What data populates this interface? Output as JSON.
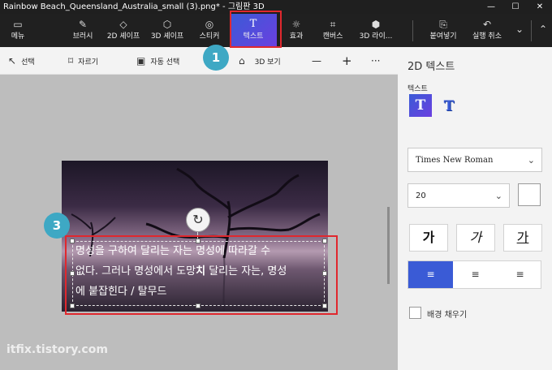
{
  "window": {
    "title": "Rainbow Beach_Queensland_Australia_small (3).png* - 그림판 3D",
    "controls": [
      "—",
      "☐",
      "✕"
    ]
  },
  "toolbar": {
    "items": [
      {
        "label": "메뉴",
        "icon": "folder-icon",
        "glyph": "▭"
      },
      {
        "label": "브러시",
        "icon": "brush-icon",
        "glyph": "✎"
      },
      {
        "label": "2D 셰이프",
        "icon": "2d-shapes-icon",
        "glyph": "◇"
      },
      {
        "label": "3D 셰이프",
        "icon": "3d-shapes-icon",
        "glyph": "⬡"
      },
      {
        "label": "스티커",
        "icon": "sticker-icon",
        "glyph": "◎"
      },
      {
        "label": "텍스트",
        "icon": "text-icon",
        "glyph": "T"
      },
      {
        "label": "효과",
        "icon": "effects-icon",
        "glyph": "☼"
      },
      {
        "label": "캔버스",
        "icon": "canvas-icon",
        "glyph": "⌗"
      },
      {
        "label": "3D 라이...",
        "icon": "3d-library-icon",
        "glyph": "⬢"
      },
      {
        "label": "붙여넣기",
        "icon": "paste-icon",
        "glyph": "⎘"
      },
      {
        "label": "실행 취소",
        "icon": "undo-icon",
        "glyph": "↶"
      }
    ],
    "more_glyph": "⌄",
    "collapse_glyph": "⌃"
  },
  "subbar": {
    "select": {
      "label": "선택",
      "glyph": "↖"
    },
    "crop": {
      "label": "자르기",
      "glyph": "⌑"
    },
    "magic_select": {
      "label": "자동 선택",
      "glyph": "▣"
    },
    "view3d": {
      "label": "3D 보기",
      "glyph": "⌂"
    },
    "zoom_out": "—",
    "zoom_in": "+",
    "more": "···"
  },
  "canvas": {
    "text_line1": "명성을 구하여 달리는 자는 명성에 따라갈 수",
    "text_line2_a": "없다. 그러나 명성에서 도망",
    "text_line2_bold": "치",
    "text_line2_b": " 달리는 자는, 명성",
    "text_line3": "에 붙잡힌다 / 탈무드",
    "rotate_glyph": "↻"
  },
  "annotations": {
    "callout1": "1",
    "callout2": "2",
    "callout3": "3",
    "accent": "#e0282e",
    "callout_color": "#3ea8c4"
  },
  "watermark": "itfix.tistory.com",
  "panel": {
    "title": "2D 텍스트",
    "subtitle": "텍스트",
    "text_2d_glyph": "T",
    "text_3d_glyph": "T",
    "font": "Times New Roman",
    "size": "20",
    "chevron": "⌄",
    "bold_label": "가",
    "italic_label": "가",
    "underline_label": "가",
    "align": {
      "left": "≡",
      "center": "≡",
      "right": "≡",
      "selected": "left"
    },
    "bg_fill_label": "배경 채우기",
    "bg_fill_checked": false,
    "accent_color": "#3a5bd6"
  }
}
